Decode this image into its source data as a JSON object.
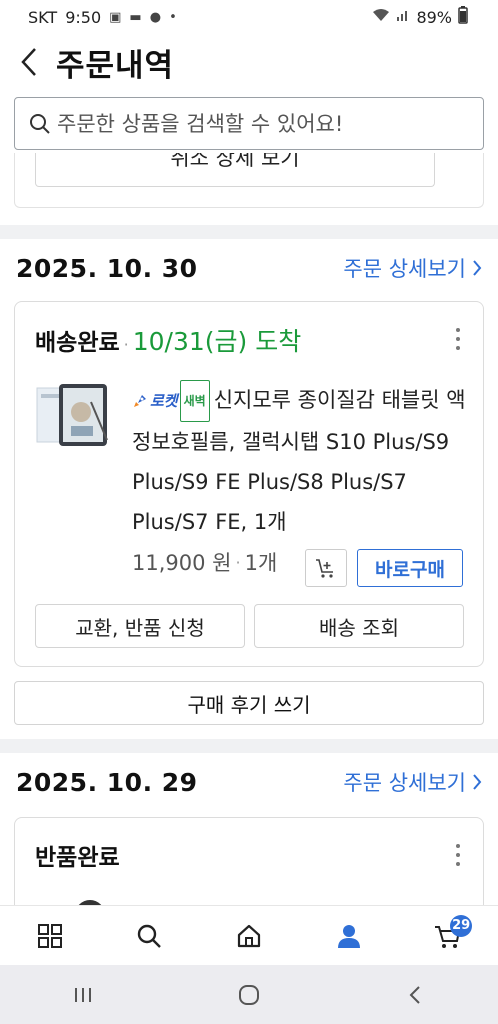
{
  "status_bar": {
    "carrier": "SKT",
    "time": "9:50",
    "battery": "89%"
  },
  "header": {
    "title": "주문내역"
  },
  "search": {
    "placeholder": "주문한 상품을 검색할 수 있어요!"
  },
  "prev_order": {
    "cut_button_label": "취소 상세 보기"
  },
  "orders": [
    {
      "date": "2025. 10. 30",
      "detail_link": "주문 상세보기",
      "status": "배송완료",
      "arrival": "10/31(금) 도착",
      "rocket_label": "로켓",
      "dawn_label": "새벽",
      "product_name": "신지모루 종이질감 태블릿 액정보호필름, 갤럭시탭 S10 Plus/S9 Plus/S9 FE Plus/S8 Plus/S7 Plus/S7 FE, 1개",
      "price": "11,900 원",
      "quantity": "1개",
      "buy_now_label": "바로구매",
      "exchange_label": "교환, 반품 신청",
      "tracking_label": "배송 조회",
      "review_label": "구매 후기 쓰기"
    },
    {
      "date": "2025. 10. 29",
      "detail_link": "주문 상세보기",
      "status": "반품완료"
    }
  ],
  "bottom_nav": {
    "cart_count": "29"
  },
  "colors": {
    "accent": "#2f6fd6",
    "arrival_green": "#1a9a3a"
  }
}
